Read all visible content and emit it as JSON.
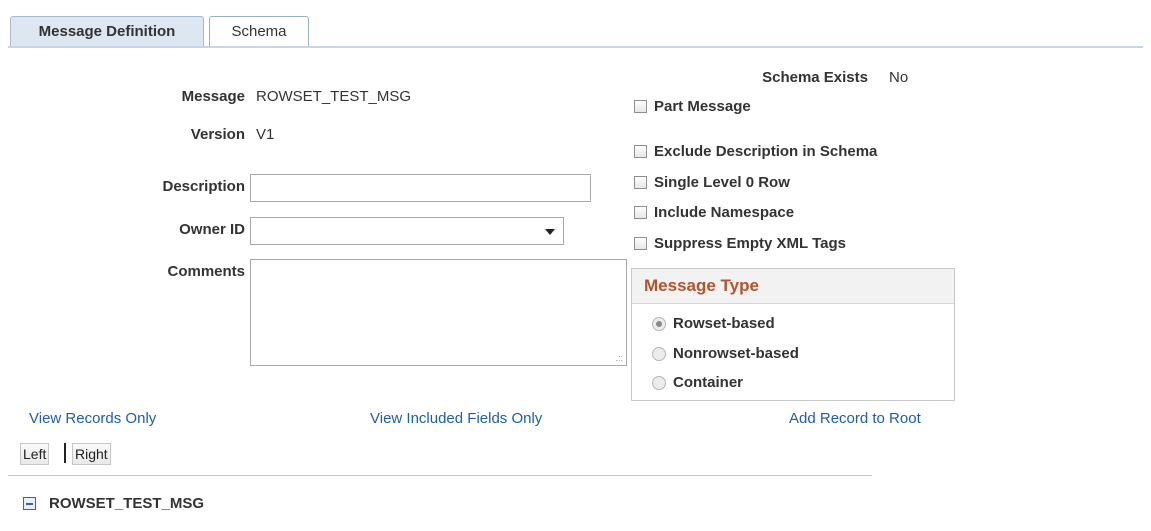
{
  "tabs": [
    {
      "label": "Message Definition",
      "active": true
    },
    {
      "label": "Schema",
      "active": false
    }
  ],
  "form": {
    "message_label": "Message",
    "message_value": "ROWSET_TEST_MSG",
    "version_label": "Version",
    "version_value": "V1",
    "description_label": "Description",
    "description_value": "",
    "owner_id_label": "Owner ID",
    "owner_id_value": "",
    "comments_label": "Comments",
    "comments_value": ""
  },
  "schema": {
    "exists_label": "Schema Exists",
    "exists_value": "No"
  },
  "checkboxes": [
    {
      "label": "Part Message",
      "checked": false
    },
    {
      "label": "Exclude Description in Schema",
      "checked": false
    },
    {
      "label": "Single Level 0 Row",
      "checked": false
    },
    {
      "label": "Include Namespace",
      "checked": false
    },
    {
      "label": "Suppress Empty XML Tags",
      "checked": false
    }
  ],
  "message_type": {
    "title": "Message Type",
    "options": [
      {
        "label": "Rowset-based",
        "selected": true
      },
      {
        "label": "Nonrowset-based",
        "selected": false
      },
      {
        "label": "Container",
        "selected": false
      }
    ]
  },
  "links": {
    "view_records_only": "View Records Only",
    "view_included_fields_only": "View Included Fields Only",
    "add_record_to_root": "Add Record to Root"
  },
  "buttons": {
    "left": "Left",
    "right": "Right"
  },
  "tree": {
    "root": "ROWSET_TEST_MSG",
    "icon": "collapse-minus-icon"
  },
  "colors": {
    "tab_active_bg": "#dde7f1",
    "link": "#1f5ea8",
    "group_title": "#b2542c"
  }
}
